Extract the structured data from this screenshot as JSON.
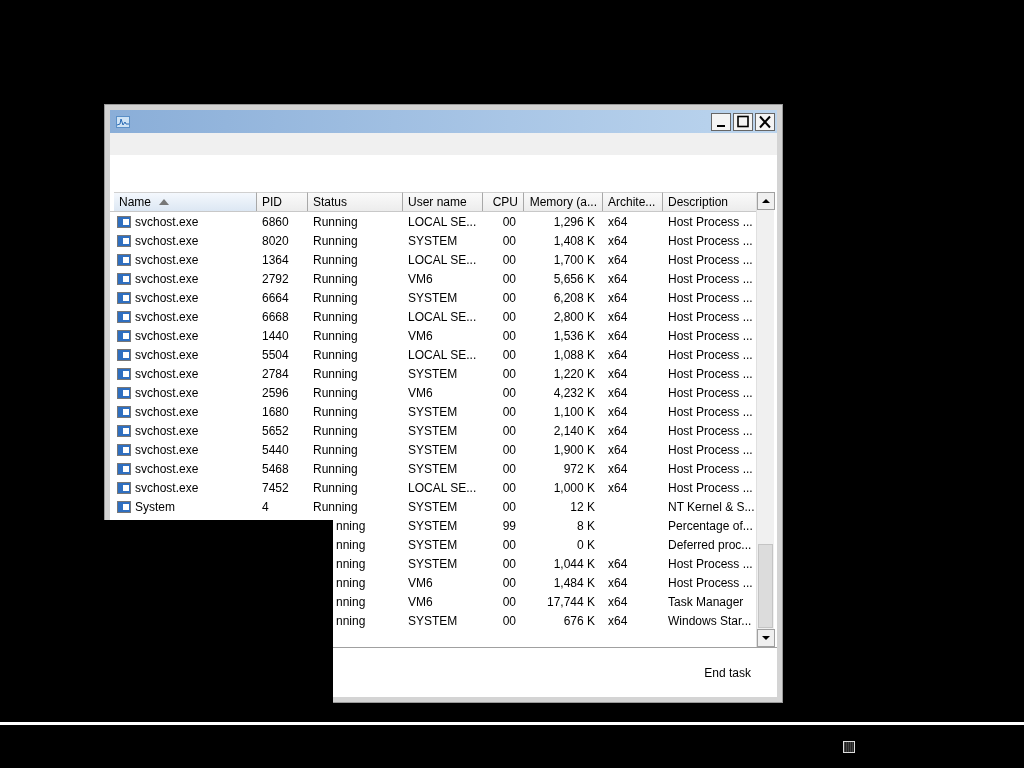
{
  "table": {
    "columns": [
      {
        "label": "Name",
        "sorted": true
      },
      {
        "label": "PID",
        "sorted": false
      },
      {
        "label": "Status",
        "sorted": false
      },
      {
        "label": "User name",
        "sorted": false
      },
      {
        "label": "CPU",
        "sorted": false
      },
      {
        "label": "Memory (a...",
        "sorted": false
      },
      {
        "label": "Archite...",
        "sorted": false
      },
      {
        "label": "Description",
        "sorted": false
      }
    ],
    "rows": [
      {
        "name": "svchost.exe",
        "pid": "6860",
        "status": "Running",
        "user": "LOCAL SE...",
        "cpu": "00",
        "memory": "1,296 K",
        "arch": "x64",
        "description": "Host Process ..."
      },
      {
        "name": "svchost.exe",
        "pid": "8020",
        "status": "Running",
        "user": "SYSTEM",
        "cpu": "00",
        "memory": "1,408 K",
        "arch": "x64",
        "description": "Host Process ..."
      },
      {
        "name": "svchost.exe",
        "pid": "1364",
        "status": "Running",
        "user": "LOCAL SE...",
        "cpu": "00",
        "memory": "1,700 K",
        "arch": "x64",
        "description": "Host Process ..."
      },
      {
        "name": "svchost.exe",
        "pid": "2792",
        "status": "Running",
        "user": "VM6",
        "cpu": "00",
        "memory": "5,656 K",
        "arch": "x64",
        "description": "Host Process ..."
      },
      {
        "name": "svchost.exe",
        "pid": "6664",
        "status": "Running",
        "user": "SYSTEM",
        "cpu": "00",
        "memory": "6,208 K",
        "arch": "x64",
        "description": "Host Process ..."
      },
      {
        "name": "svchost.exe",
        "pid": "6668",
        "status": "Running",
        "user": "LOCAL SE...",
        "cpu": "00",
        "memory": "2,800 K",
        "arch": "x64",
        "description": "Host Process ..."
      },
      {
        "name": "svchost.exe",
        "pid": "1440",
        "status": "Running",
        "user": "VM6",
        "cpu": "00",
        "memory": "1,536 K",
        "arch": "x64",
        "description": "Host Process ..."
      },
      {
        "name": "svchost.exe",
        "pid": "5504",
        "status": "Running",
        "user": "LOCAL SE...",
        "cpu": "00",
        "memory": "1,088 K",
        "arch": "x64",
        "description": "Host Process ..."
      },
      {
        "name": "svchost.exe",
        "pid": "2784",
        "status": "Running",
        "user": "SYSTEM",
        "cpu": "00",
        "memory": "1,220 K",
        "arch": "x64",
        "description": "Host Process ..."
      },
      {
        "name": "svchost.exe",
        "pid": "2596",
        "status": "Running",
        "user": "VM6",
        "cpu": "00",
        "memory": "4,232 K",
        "arch": "x64",
        "description": "Host Process ..."
      },
      {
        "name": "svchost.exe",
        "pid": "1680",
        "status": "Running",
        "user": "SYSTEM",
        "cpu": "00",
        "memory": "1,100 K",
        "arch": "x64",
        "description": "Host Process ..."
      },
      {
        "name": "svchost.exe",
        "pid": "5652",
        "status": "Running",
        "user": "SYSTEM",
        "cpu": "00",
        "memory": "2,140 K",
        "arch": "x64",
        "description": "Host Process ..."
      },
      {
        "name": "svchost.exe",
        "pid": "5440",
        "status": "Running",
        "user": "SYSTEM",
        "cpu": "00",
        "memory": "1,900 K",
        "arch": "x64",
        "description": "Host Process ..."
      },
      {
        "name": "svchost.exe",
        "pid": "5468",
        "status": "Running",
        "user": "SYSTEM",
        "cpu": "00",
        "memory": "972 K",
        "arch": "x64",
        "description": "Host Process ..."
      },
      {
        "name": "svchost.exe",
        "pid": "7452",
        "status": "Running",
        "user": "LOCAL SE...",
        "cpu": "00",
        "memory": "1,000 K",
        "arch": "x64",
        "description": "Host Process ..."
      },
      {
        "name": "System",
        "pid": "4",
        "status": "Running",
        "user": "SYSTEM",
        "cpu": "00",
        "memory": "12 K",
        "description": "NT Kernel & S..."
      },
      {
        "status": "nning",
        "user": "SYSTEM",
        "cpu": "99",
        "memory": "8 K",
        "description": "Percentage of..."
      },
      {
        "status": "nning",
        "user": "SYSTEM",
        "cpu": "00",
        "memory": "0 K",
        "description": "Deferred proc..."
      },
      {
        "status": "nning",
        "user": "SYSTEM",
        "cpu": "00",
        "memory": "1,044 K",
        "arch": "x64",
        "description": "Host Process ..."
      },
      {
        "status": "nning",
        "user": "VM6",
        "cpu": "00",
        "memory": "1,484 K",
        "arch": "x64",
        "description": "Host Process ..."
      },
      {
        "status": "nning",
        "user": "VM6",
        "cpu": "00",
        "memory": "17,744 K",
        "arch": "x64",
        "description": "Task Manager"
      },
      {
        "status": "nning",
        "user": "SYSTEM",
        "cpu": "00",
        "memory": "676 K",
        "arch": "x64",
        "description": "Windows Star..."
      }
    ]
  },
  "buttons": [
    "End task"
  ]
}
